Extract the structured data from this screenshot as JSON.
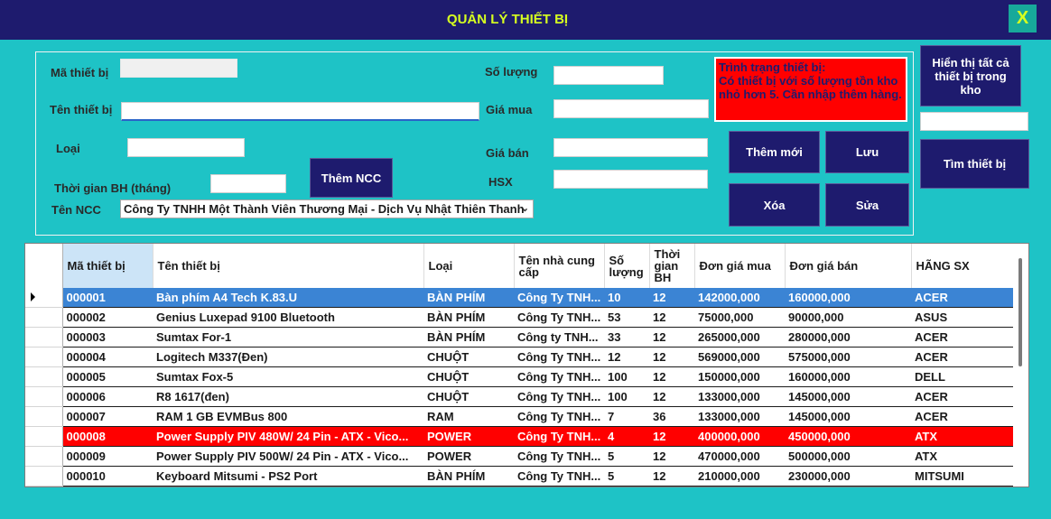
{
  "window": {
    "title": "QUẢN LÝ THIẾT BỊ",
    "close_label": "X"
  },
  "form": {
    "ma_thiet_bi_label": "Mã thiết bị",
    "ma_thiet_bi_value": "",
    "ten_thiet_bi_label": "Tên thiết bị",
    "ten_thiet_bi_value": "",
    "loai_label": "Loại",
    "loai_value": "",
    "thoi_gian_bh_label": "Thời gian BH (tháng)",
    "thoi_gian_bh_value": "",
    "ten_ncc_label": "Tên NCC",
    "ten_ncc_value": "Công Ty TNHH Một Thành Viên Thương Mại - Dịch Vụ Nhật Thiên Thanh",
    "so_luong_label": "Số lượng",
    "so_luong_value": "",
    "gia_mua_label": "Giá mua",
    "gia_mua_value": "",
    "gia_ban_label": "Giá bán",
    "gia_ban_value": "",
    "hsx_label": "HSX",
    "hsx_value": "",
    "search_value": ""
  },
  "buttons": {
    "them_ncc": "Thêm NCC",
    "them_moi": "Thêm mới",
    "luu": "Lưu",
    "xoa": "Xóa",
    "sua": "Sửa",
    "hien_thi": "Hiển thị tất cả thiết bị trong kho",
    "tim": "Tìm thiết bị"
  },
  "status_message": "Trình trạng thiết bị:\nCó thiết bị với số lượng tồn kho nhỏ hơn 5. Cần nhập thêm hàng.",
  "grid": {
    "headers": [
      "Mã thiết bị",
      "Tên thiết bị",
      "Loại",
      "Tên nhà cung cấp",
      "Số lượng",
      "Thời gian BH",
      "Đơn giá mua",
      "Đơn giá bán",
      "HÃNG SX"
    ],
    "rows": [
      [
        "000001",
        "Bàn phím A4 Tech K.83.U",
        "BÀN PHÍM",
        "Công Ty TNH...",
        "10",
        "12",
        "142000,000",
        "160000,000",
        "ACER"
      ],
      [
        "000002",
        "Genius Luxepad 9100 Bluetooth",
        "BÀN PHÍM",
        "Công Ty TNH...",
        "53",
        "12",
        "75000,000",
        "90000,000",
        "ASUS"
      ],
      [
        "000003",
        "Sumtax For-1",
        "BÀN PHÍM",
        "Công ty TNH...",
        "33",
        "12",
        "265000,000",
        "280000,000",
        "ACER"
      ],
      [
        "000004",
        "Logitech M337(Đen)",
        "CHUỘT",
        "Công Ty TNH...",
        "12",
        "12",
        "569000,000",
        "575000,000",
        "ACER"
      ],
      [
        "000005",
        "Sumtax Fox-5",
        "CHUỘT",
        "Công Ty TNH...",
        "100",
        "12",
        "150000,000",
        "160000,000",
        "DELL"
      ],
      [
        "000006",
        "R8 1617(đen)",
        "CHUỘT",
        "Công Ty TNH...",
        "100",
        "12",
        "133000,000",
        "145000,000",
        "ACER"
      ],
      [
        "000007",
        "RAM 1 GB EVMBus 800",
        "RAM",
        "Công Ty TNH...",
        "7",
        "36",
        "133000,000",
        "145000,000",
        "ACER"
      ],
      [
        "000008",
        "Power Supply PIV 480W/ 24 Pin  - ATX - Vico...",
        "POWER",
        "Công Ty TNH...",
        "4",
        "12",
        "400000,000",
        "450000,000",
        "ATX"
      ],
      [
        "000009",
        "Power Supply PIV 500W/ 24 Pin  - ATX - Vico...",
        "POWER",
        "Công Ty TNH...",
        "5",
        "12",
        "470000,000",
        "500000,000",
        "ATX"
      ],
      [
        "000010",
        "Keyboard  Mitsumi - PS2 Port",
        "BÀN PHÍM",
        "Công Ty TNH...",
        "5",
        "12",
        "210000,000",
        "230000,000",
        "MITSUMI"
      ]
    ],
    "selected_row": 0,
    "highlight_row": 7
  },
  "colors": {
    "titlebar": "#1e1b6e",
    "background": "#1ec3c6",
    "title_text": "#d6ff20",
    "button": "#1e1b6e",
    "status": "#ff0000",
    "selected_row": "#3b84d4",
    "alert_row": "#ff0000"
  }
}
